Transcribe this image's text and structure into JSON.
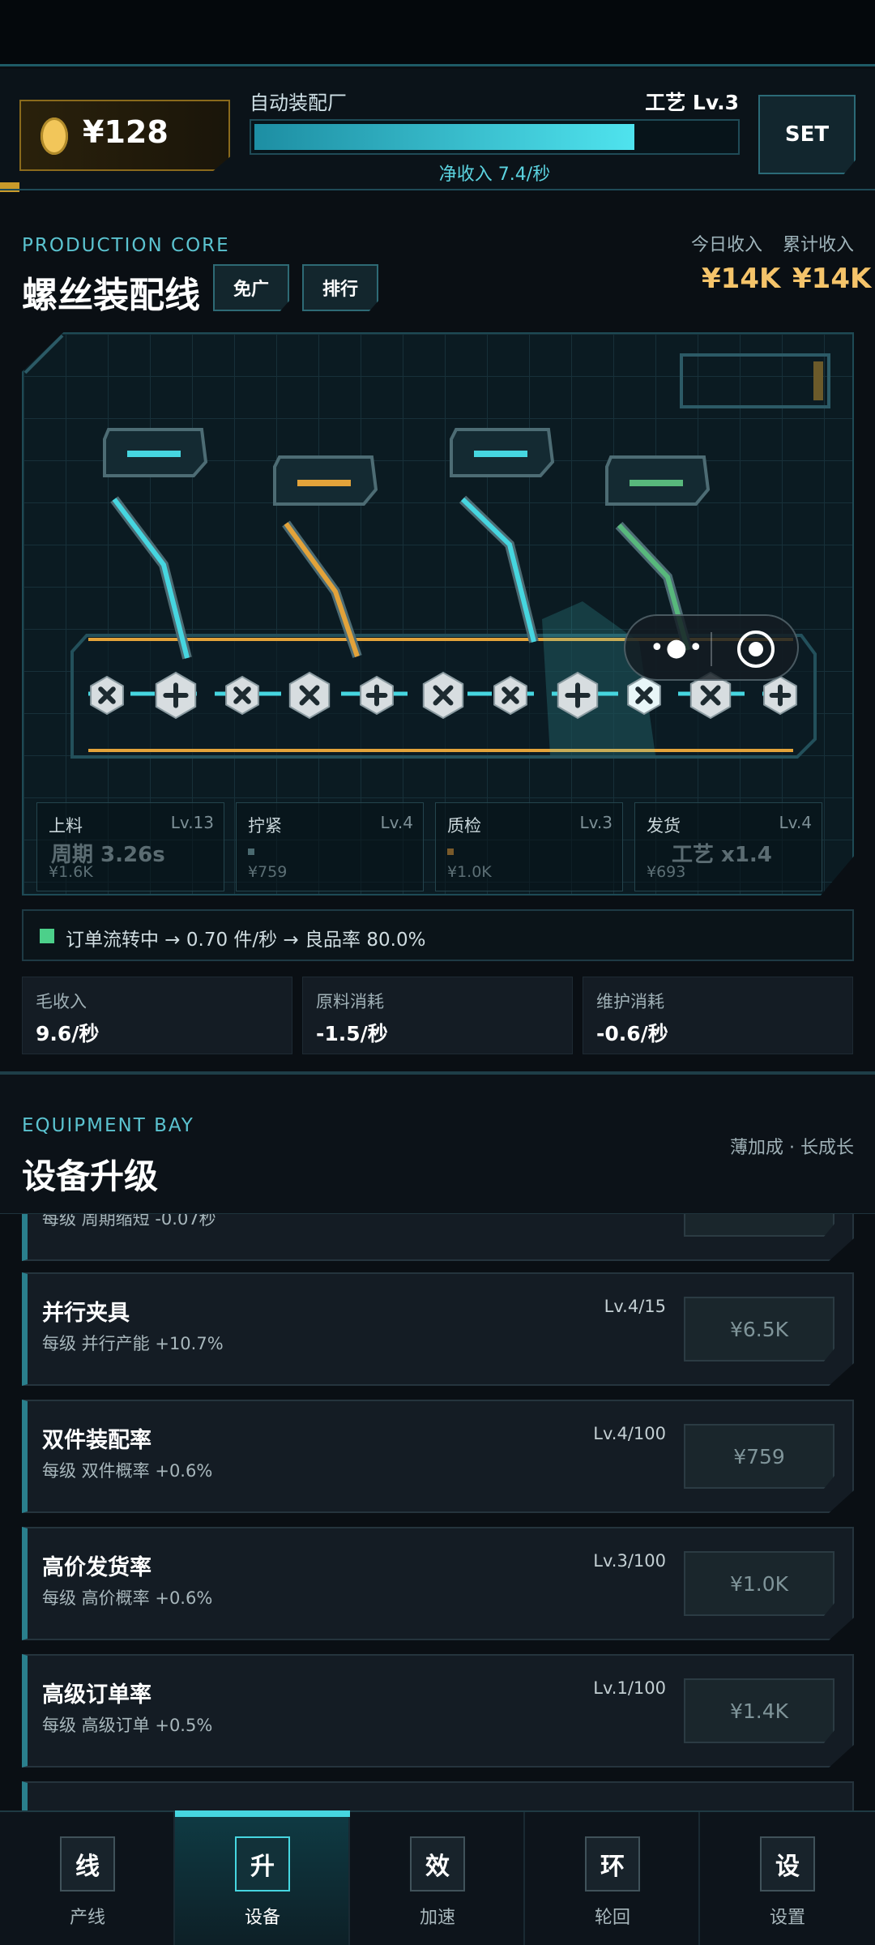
{
  "header": {
    "coins": "¥128",
    "factory_name": "自动装配厂",
    "tech_level": "工艺 Lv.3",
    "progress": 0.78,
    "income_rate": "净收入 7.4/秒",
    "set_label": "SET"
  },
  "production": {
    "eyebrow": "PRODUCTION CORE",
    "title": "螺丝装配线",
    "chips": {
      "ad_free": "免广",
      "rank": "排行"
    },
    "stats": {
      "today_label": "今日收入",
      "today_value": "¥14K",
      "total_label": "累计收入",
      "total_value": "¥14K"
    },
    "stations": [
      {
        "name": "上料",
        "level": "Lv.13",
        "cost": "¥1.6K"
      },
      {
        "name": "拧紧",
        "level": "Lv.4",
        "cost": "¥759"
      },
      {
        "name": "质检",
        "level": "Lv.3",
        "cost": "¥1.0K"
      },
      {
        "name": "发货",
        "level": "Lv.4",
        "cost": "¥693"
      }
    ],
    "overlay": {
      "cycle": "周期 3.26s",
      "tech": "工艺 x1.4"
    },
    "capsule": {
      "dots": "•●•"
    },
    "flow": {
      "text": "订单流转中 → 0.70 件/秒 → 良品率 80.0%"
    },
    "kpis": [
      {
        "label": "毛收入",
        "value": "9.6/秒"
      },
      {
        "label": "原料消耗",
        "value": "-1.5/秒"
      },
      {
        "label": "维护消耗",
        "value": "-0.6/秒"
      }
    ],
    "colors": {
      "cyan": "#46d6e0",
      "gold": "#e3a33a",
      "green": "#58b87c"
    }
  },
  "equipment": {
    "eyebrow": "EQUIPMENT BAY",
    "title": "设备升级",
    "hint": "薄加成 · 长成长",
    "partial_top_desc": "每级 周期缩短 -0.07秒",
    "cards": [
      {
        "name": "并行夹具",
        "desc": "每级 并行产能 +10.7%",
        "level": "Lv.4/15",
        "cost": "¥6.5K"
      },
      {
        "name": "双件装配率",
        "desc": "每级 双件概率 +0.6%",
        "level": "Lv.4/100",
        "cost": "¥759"
      },
      {
        "name": "高价发货率",
        "desc": "每级 高价概率 +0.6%",
        "level": "Lv.3/100",
        "cost": "¥1.0K"
      },
      {
        "name": "高级订单率",
        "desc": "每级 高级订单 +0.5%",
        "level": "Lv.1/100",
        "cost": "¥1.4K"
      }
    ]
  },
  "nav": {
    "items": [
      {
        "icon": "线",
        "label": "产线",
        "icon_name": "line-icon"
      },
      {
        "icon": "升",
        "label": "设备",
        "icon_name": "upgrade-icon",
        "active": true
      },
      {
        "icon": "效",
        "label": "加速",
        "icon_name": "boost-icon"
      },
      {
        "icon": "环",
        "label": "轮回",
        "icon_name": "cycle-icon"
      },
      {
        "icon": "设",
        "label": "设置",
        "icon_name": "settings-icon"
      }
    ]
  }
}
